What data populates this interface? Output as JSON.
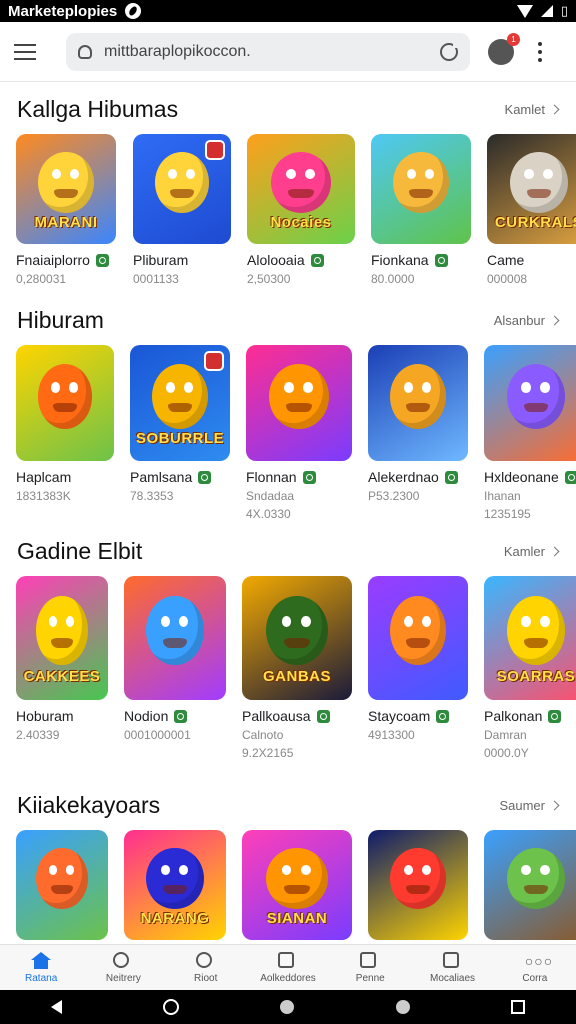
{
  "status_bar": {
    "app_name": "Marketeplopies",
    "icons": [
      "app-icon",
      "wifi-icon",
      "signal-icon",
      "battery-icon"
    ]
  },
  "toolbar": {
    "url": "mittbaraplopikoccon.",
    "icons": [
      "menu-icon",
      "lock-icon",
      "reload-icon",
      "profile-icon",
      "more-icon"
    ],
    "profile_badge": "1"
  },
  "sections": [
    {
      "title": "Kallga Hibumas",
      "more": "Kamlet",
      "items": [
        {
          "name": "Fnaiaiplorro",
          "sub": "0,280031",
          "verified": true,
          "colors": [
            "#ff8a1f",
            "#ffd43b",
            "#3a86ff"
          ],
          "label": "MARANI"
        },
        {
          "name": "Pliburam",
          "sub": "0001133",
          "verified": false,
          "colors": [
            "#2f6cf5",
            "#ffd43b",
            "#1e4bd1"
          ],
          "label": ""
        },
        {
          "name": "Alolooaia",
          "sub": "2,50300",
          "verified": true,
          "colors": [
            "#ff9f1c",
            "#ff3f8e",
            "#6bd14a"
          ],
          "label": "Nocaies"
        },
        {
          "name": "Fionkana",
          "sub": "80.0000",
          "verified": true,
          "colors": [
            "#4ec8f5",
            "#f6b93b",
            "#5fc34a"
          ],
          "label": ""
        },
        {
          "name": "Came",
          "sub": "000008",
          "verified": false,
          "colors": [
            "#2a2a2a",
            "#d9d2c5",
            "#e0a340"
          ],
          "label": "CURKRALS"
        }
      ]
    },
    {
      "title": "Hiburam",
      "more": "Alsanbur",
      "items": [
        {
          "name": "Haplcam",
          "sub": "1831383K",
          "sub2": "",
          "verified": false,
          "colors": [
            "#ffd400",
            "#ff6a13",
            "#6cc24a"
          ],
          "label": ""
        },
        {
          "name": "Pamlsana",
          "sub": "78.3353",
          "sub2": "",
          "verified": true,
          "colors": [
            "#1a56d6",
            "#f7b500",
            "#2e8cf0"
          ],
          "label": "SOBURRLE"
        },
        {
          "name": "Flonnan",
          "sub": "Sndadaa",
          "sub2": "4X.0330",
          "verified": true,
          "colors": [
            "#ff2d91",
            "#ff9500",
            "#7a3cff"
          ],
          "label": ""
        },
        {
          "name": "Alekerdnao",
          "sub": "P53.2300",
          "sub2": "",
          "verified": true,
          "colors": [
            "#1b3fb5",
            "#f5a623",
            "#6fb8ff"
          ],
          "label": ""
        },
        {
          "name": "Hxldeonane",
          "sub": "Ihanan",
          "sub2": "1235195",
          "verified": true,
          "colors": [
            "#3aa0ff",
            "#8a5cff",
            "#ff6b2c"
          ],
          "label": ""
        }
      ]
    },
    {
      "title": "Gadine Elbit",
      "more": "Kamler",
      "items": [
        {
          "name": "Hoburam",
          "sub": "2.40339",
          "sub2": "",
          "verified": false,
          "colors": [
            "#ff3fb8",
            "#ffd400",
            "#45c84f"
          ],
          "label": "CAKKEES"
        },
        {
          "name": "Nodion",
          "sub": "0001000001",
          "sub2": "",
          "verified": true,
          "colors": [
            "#ff6b2c",
            "#3aa0ff",
            "#a23cff"
          ],
          "label": ""
        },
        {
          "name": "Pallkoausa",
          "sub": "Calnoto",
          "sub2": "9.2X2165",
          "verified": true,
          "colors": [
            "#f2a900",
            "#2f6b1f",
            "#1a1a3a"
          ],
          "label": "GANBAS"
        },
        {
          "name": "Staycoam",
          "sub": "4913300",
          "sub2": "",
          "verified": true,
          "colors": [
            "#9b3cff",
            "#ff8a1f",
            "#3f5bff"
          ],
          "label": ""
        },
        {
          "name": "Palkonan",
          "sub": "Damran",
          "sub2": "0000.0Y",
          "verified": true,
          "colors": [
            "#3ab6ff",
            "#ffd400",
            "#ff4f6a"
          ],
          "label": "SOARRAS"
        }
      ]
    },
    {
      "title": "Kiiakekayoars",
      "more": "Saumer",
      "items": [
        {
          "name": "",
          "sub": "",
          "verified": false,
          "colors": [
            "#3aa0ff",
            "#ff6b2c",
            "#6cc24a"
          ],
          "label": ""
        },
        {
          "name": "",
          "sub": "",
          "verified": false,
          "colors": [
            "#ff2d91",
            "#2b2bd6",
            "#ffd400"
          ],
          "label": "NARANG"
        },
        {
          "name": "",
          "sub": "",
          "verified": false,
          "colors": [
            "#ff3fb8",
            "#ff9500",
            "#7a3cff"
          ],
          "label": "SIANAN"
        },
        {
          "name": "",
          "sub": "",
          "verified": false,
          "colors": [
            "#0d1b6b",
            "#ff3b30",
            "#ffd400"
          ],
          "label": ""
        },
        {
          "name": "",
          "sub": "",
          "verified": false,
          "colors": [
            "#3aa0ff",
            "#6cc24a",
            "#8a5a2b"
          ],
          "label": ""
        }
      ]
    }
  ],
  "bottom_nav": [
    {
      "label": "Ratana",
      "icon": "home-icon",
      "active": true
    },
    {
      "label": "Neitrery",
      "icon": "search-icon",
      "active": false
    },
    {
      "label": "Rioot",
      "icon": "search-icon",
      "active": false
    },
    {
      "label": "Aolkeddores",
      "icon": "edit-icon",
      "active": false
    },
    {
      "label": "Penne",
      "icon": "bag-icon",
      "active": false
    },
    {
      "label": "Mocaliaes",
      "icon": "square-icon",
      "active": false
    },
    {
      "label": "Corra",
      "icon": "dots-icon",
      "active": false
    }
  ]
}
